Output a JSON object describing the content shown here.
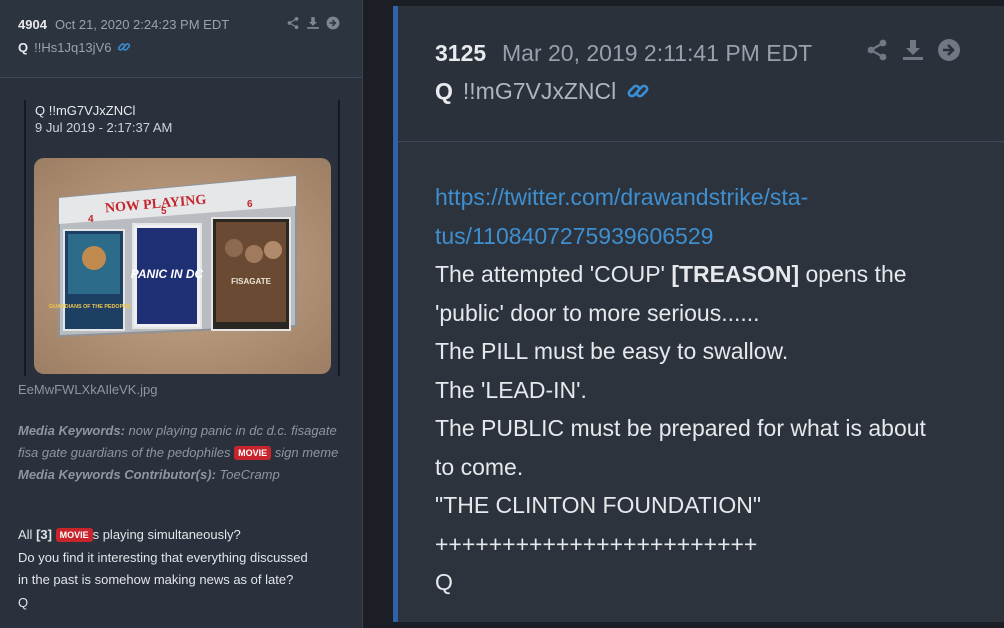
{
  "left_post": {
    "number": "4904",
    "date": "Oct 21, 2020 2:24:23 PM EDT",
    "author": "Q",
    "tripcode": "!!Hs1Jq13jV6",
    "quote": {
      "author": "Q  !!mG7VJxZNCl",
      "date": "9 Jul 2019 - 2:17:37 AM",
      "image": {
        "board_title": "NOW PLAYING",
        "screen_numbers": [
          "4",
          "5",
          "6"
        ],
        "posters": [
          "GUARDIANS OF THE PEDOPHILES",
          "PANIC IN DC",
          "FISAGATE"
        ]
      }
    },
    "filename": "EeMwFWLXkAIleVK.jpg",
    "media_keywords_label": "Media Keywords:",
    "media_keywords_text": "now playing panic in dc d.c. fisagate fisa gate guardians of the pedophiles",
    "movie_tag": "MOVIE",
    "media_keywords_suffix": "sign meme",
    "contributor_label": "Media Keywords Contributor(s):",
    "contributor": "ToeCramp",
    "body": {
      "line1_prefix": "All ",
      "line1_bold": "[3]",
      "line1_tag": "MOVIE",
      "line1_suffix": "s playing simultaneously?",
      "line2": "Do you find it interesting that everything discussed",
      "line3": "in the past is somehow making news as of late?",
      "line4": "Q"
    }
  },
  "right_post": {
    "number": "3125",
    "date": "Mar 20, 2019 2:11:41 PM EDT",
    "author": "Q",
    "tripcode": "!!mG7VJxZNCl",
    "link_line1": "https://twitter.com/drawandstrike/sta-",
    "link_line2": "tus/1108407275939606529",
    "line1_prefix": "The attempted 'COUP' ",
    "line1_bold": "[TREASON]",
    "line1_suffix": " opens the",
    "line2": "'public' door to more serious......",
    "line3": "The PILL must be easy to swallow.",
    "line4": "The 'LEAD-IN'.",
    "line5": "The PUBLIC must be prepared for what is about",
    "line6": "to come.",
    "line7": "\"THE CLINTON FOUNDATION\"",
    "line8": "++++++++++++++++++++++++",
    "line9": "Q"
  },
  "icons": [
    "share-icon",
    "download-icon",
    "forward-icon",
    "link-icon"
  ],
  "colors": {
    "accent": "#2e64a7",
    "link": "#3f8fcf",
    "tag": "#c8242b"
  }
}
